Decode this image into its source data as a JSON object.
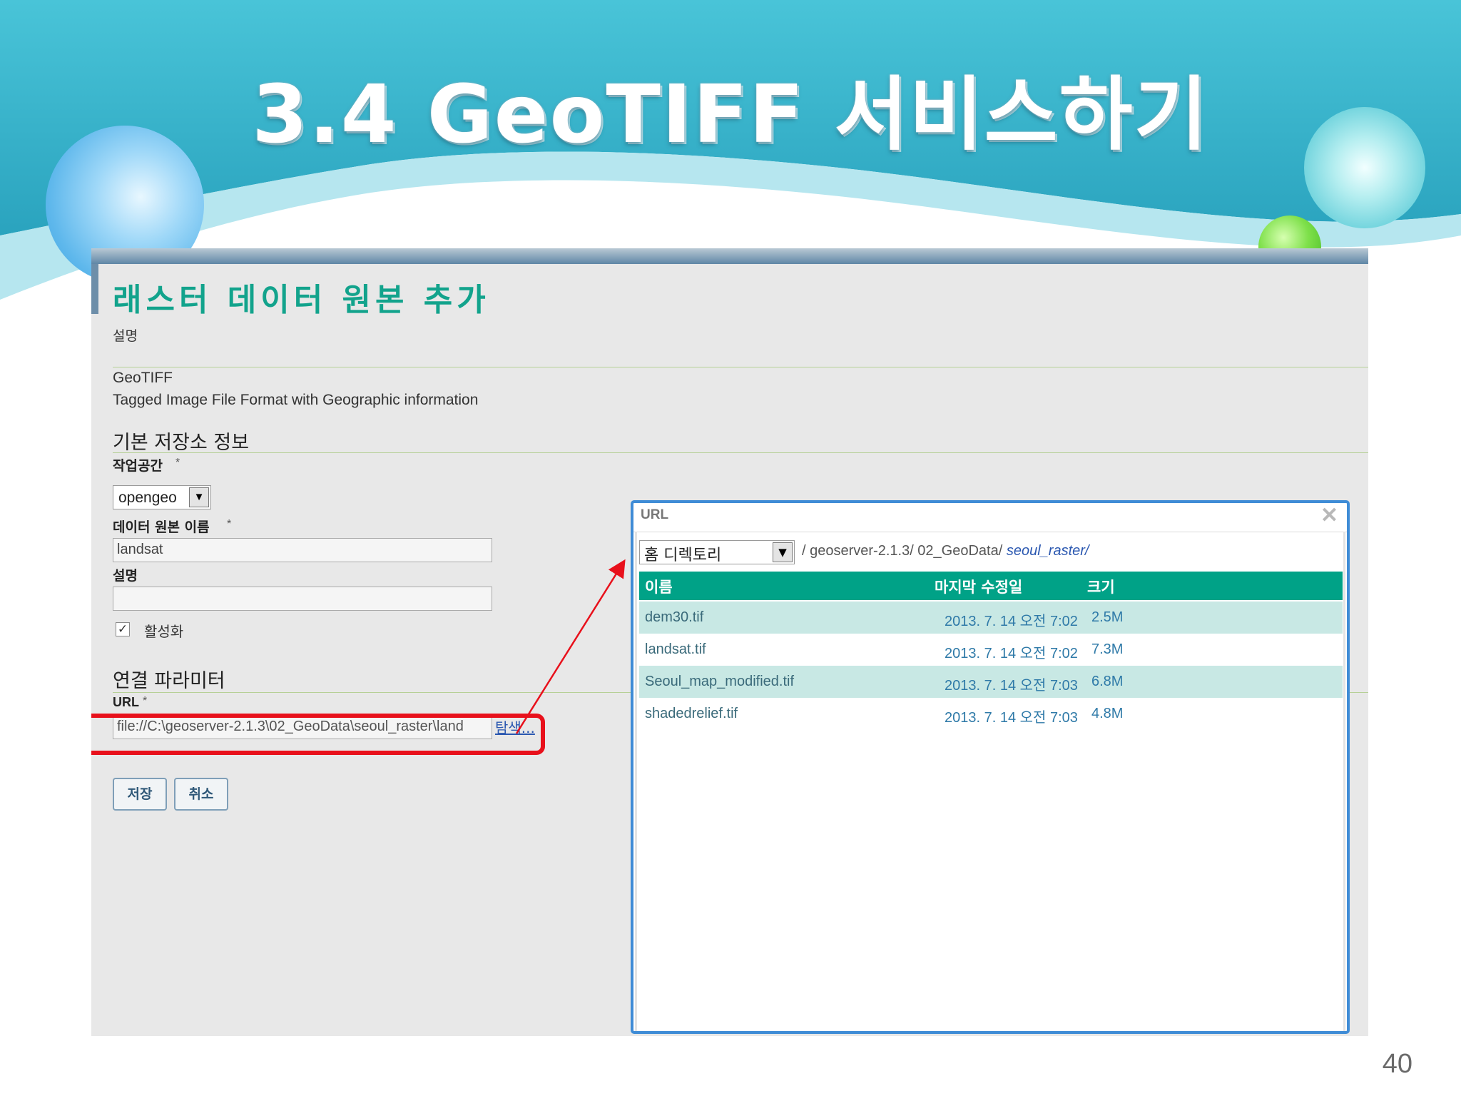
{
  "slide": {
    "title": "3.4 GeoTIFF 서비스하기",
    "page_number": "40"
  },
  "form": {
    "heading": "래스터 데이터 원본 추가",
    "description_label": "설명",
    "source_type": "GeoTIFF",
    "source_type_desc": "Tagged Image File Format with Geographic information",
    "basic_info_title": "기본 저장소 정보",
    "workspace_label": "작업공간",
    "workspace_value": "opengeo",
    "datasource_name_label": "데이터 원본 이름",
    "datasource_name_value": "landsat",
    "desc_field_label": "설명",
    "desc_field_value": "",
    "enabled_label": "활성화",
    "enabled": true,
    "connection_title": "연결 파라미터",
    "url_label": "URL",
    "url_value": "file://C:\\geoserver-2.1.3\\02_GeoData\\seoul_raster\\land",
    "browse_label": "탐색...",
    "required_mark": "*",
    "save_label": "저장",
    "cancel_label": "취소"
  },
  "dialog": {
    "title": "URL",
    "close_glyph": "✕",
    "root_select": "홈 디렉토리",
    "path_prefix": "/ geoserver-2.1.3/ 02_GeoData/",
    "path_current": "seoul_raster/",
    "columns": [
      "이름",
      "마지막 수정일",
      "크기"
    ],
    "files": [
      {
        "name": "dem30.tif",
        "modified": "2013. 7. 14 오전 7:02",
        "size": "2.5M"
      },
      {
        "name": "landsat.tif",
        "modified": "2013. 7. 14 오전 7:02",
        "size": "7.3M"
      },
      {
        "name": "Seoul_map_modified.tif",
        "modified": "2013. 7. 14 오전 7:03",
        "size": "6.8M"
      },
      {
        "name": "shadedrelief.tif",
        "modified": "2013. 7. 14 오전 7:03",
        "size": "4.8M"
      }
    ]
  },
  "colors": {
    "heading_green": "#12a38c",
    "table_header": "#00a287",
    "highlight_red": "#e8101b",
    "dialog_border": "#3f8cd6"
  }
}
